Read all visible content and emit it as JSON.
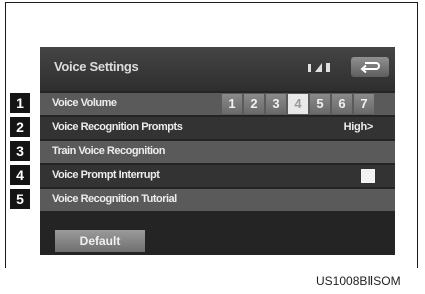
{
  "screen": {
    "title": "Voice Settings",
    "back_icon": "back-arrow-icon",
    "status_icons": [
      "bluetooth-icon",
      "signal-icon",
      "battery-icon"
    ]
  },
  "rows": [
    {
      "label": "Voice Volume",
      "badge": "1"
    },
    {
      "label": "Voice Recognition Prompts",
      "badge": "2",
      "value": "High"
    },
    {
      "label": "Train Voice Recognition",
      "badge": "3"
    },
    {
      "label": "Voice Prompt Interrupt",
      "badge": "4",
      "checked": false
    },
    {
      "label": "Voice Recognition Tutorial",
      "badge": "5"
    }
  ],
  "volume": {
    "levels": [
      "1",
      "2",
      "3",
      "4",
      "5",
      "6",
      "7"
    ],
    "selected": "4"
  },
  "default_label": "Default",
  "image_code": "US1008BⅡSOM"
}
